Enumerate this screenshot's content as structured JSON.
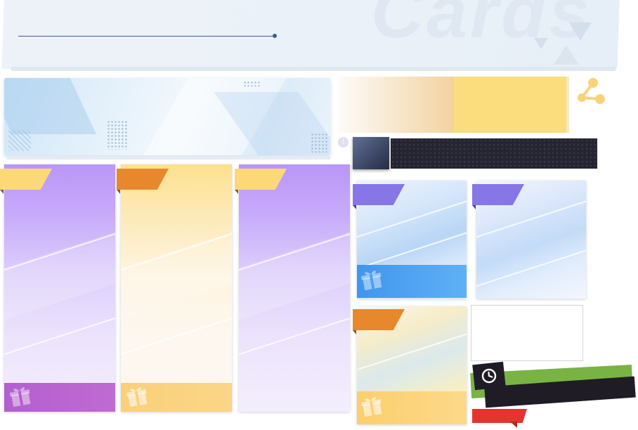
{
  "header": {
    "watermark_text": "Cards",
    "background_color": "#eaf1f8",
    "accent_line_color": "#3d5a8c"
  },
  "banner": {
    "style": "light-blue-geometric",
    "accent_color": "#cfe6f8"
  },
  "gradient_banner": {
    "colors": [
      "#fdfbf7",
      "#f3d2a0",
      "#fbdd7d"
    ]
  },
  "share": {
    "icon": "share-icon",
    "color": "#fbd279"
  },
  "dark_bar": {
    "color": "#252431",
    "thumbnail_color": "#3b4667"
  },
  "info_icon": {
    "glyph": "!"
  },
  "tall_cards": [
    {
      "theme": "purple",
      "tag_color": "#fcd879",
      "footer_color": "#b35fcf",
      "icon": "gift-icon"
    },
    {
      "theme": "yellow",
      "tag_color": "#e7882d",
      "footer_color": "#fad07a",
      "icon": "gift-icon"
    },
    {
      "theme": "purple",
      "tag_color": "#fcd879",
      "footer_color": "",
      "icon": ""
    }
  ],
  "small_cards": [
    {
      "theme": "blue",
      "tag_color": "#8776e6",
      "footer_color": "#4aa0f0",
      "icon": "gift-icon"
    },
    {
      "theme": "aqua",
      "tag_color": "#8776e6",
      "footer_color": "",
      "icon": ""
    },
    {
      "theme": "pastel",
      "tag_color": "#e7882d",
      "footer_color": "#fbd276",
      "icon": "gift-icon"
    }
  ],
  "time_badge": {
    "icon": "clock-icon",
    "stripe_color": "#79b343",
    "bar_color": "#1f1c26"
  },
  "red_tag": {
    "color": "#e3352e"
  }
}
